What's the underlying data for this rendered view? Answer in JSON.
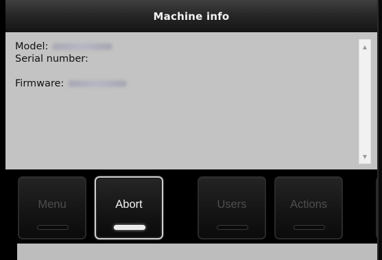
{
  "window": {
    "title": "Machine info"
  },
  "info": {
    "model_label": "Model:",
    "serial_label": "Serial number:",
    "firmware_label": "Firmware:"
  },
  "scrollbar": {
    "up_icon": "arrow-up-icon",
    "down_icon": "arrow-down-icon"
  },
  "buttons": [
    {
      "label": "Menu",
      "active": false
    },
    {
      "label": "Abort",
      "active": true
    },
    {
      "label": "Users",
      "active": false
    },
    {
      "label": "Actions",
      "active": false
    }
  ],
  "colors": {
    "panel_bg": "#c3c3c3",
    "title_text": "#f2f2f2",
    "inactive_label": "#4e4e4e",
    "active_label": "#f2f2f2"
  }
}
